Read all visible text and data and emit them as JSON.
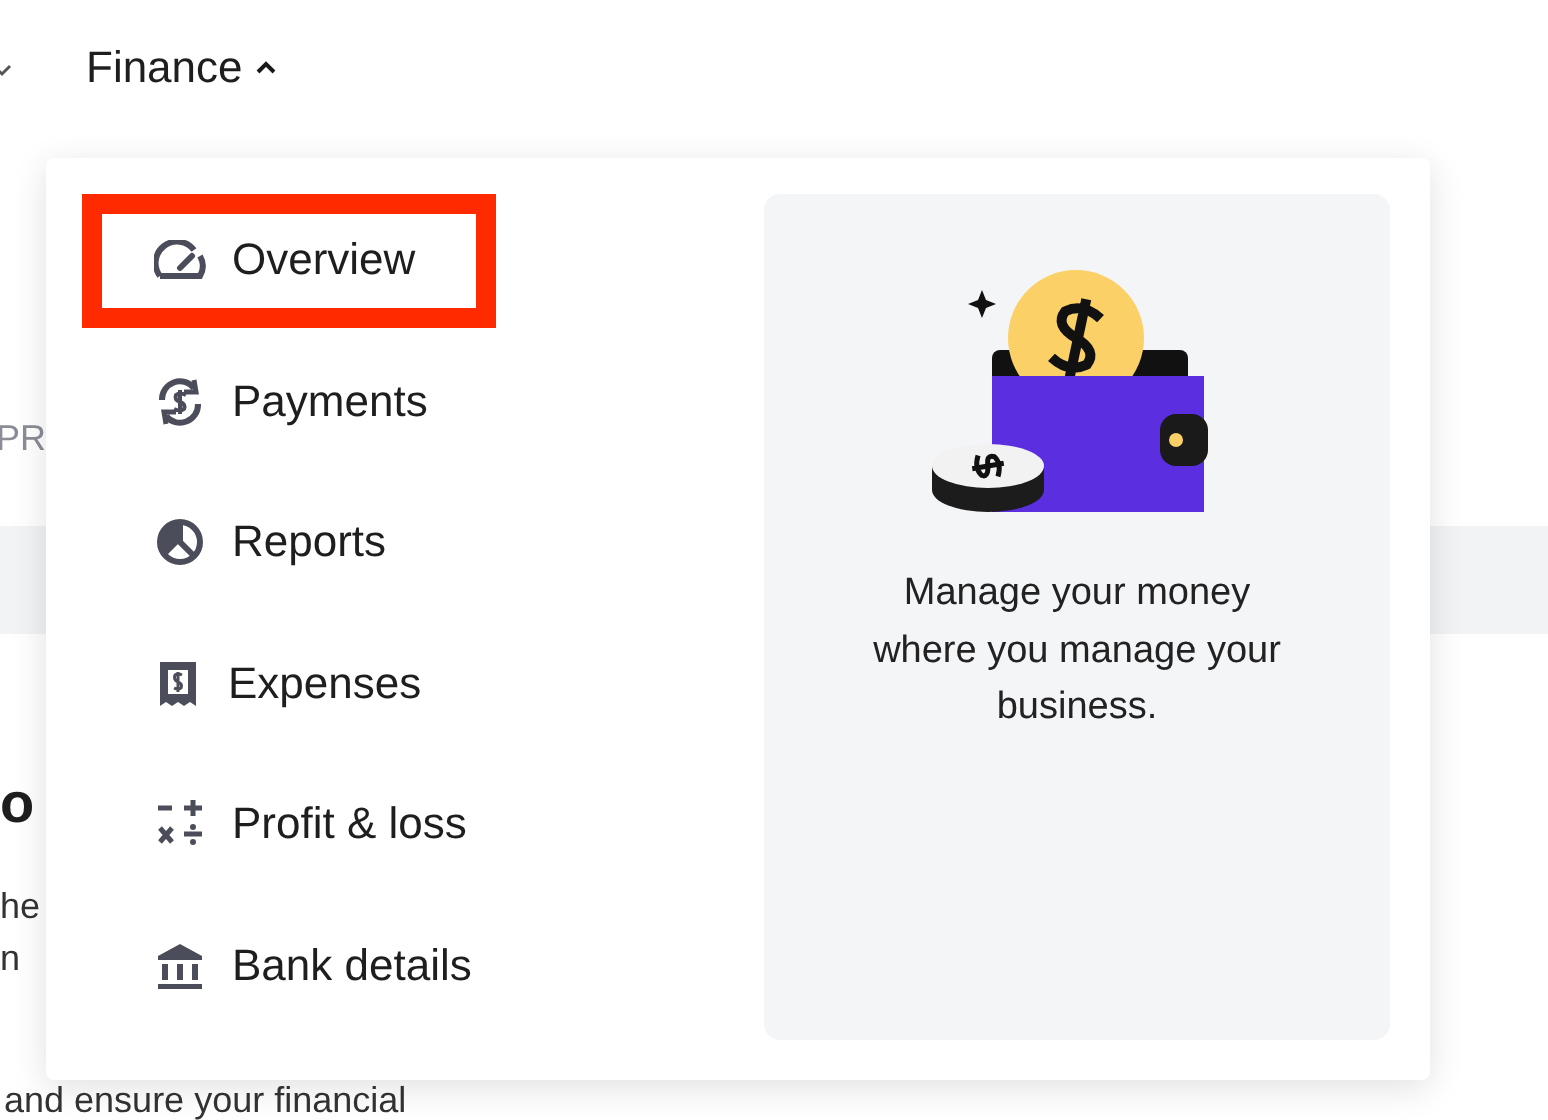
{
  "nav": {
    "label": "Finance",
    "expanded": true
  },
  "background": {
    "tab_fragment": "PR",
    "heading_fragment": "o",
    "line_1": "he",
    "line_2": "n",
    "line_3": "and ensure your financial"
  },
  "menu": {
    "items": [
      {
        "label": "Overview",
        "highlighted": true
      },
      {
        "label": "Payments",
        "highlighted": false
      },
      {
        "label": "Reports",
        "highlighted": false
      },
      {
        "label": "Expenses",
        "highlighted": false
      },
      {
        "label": "Profit & loss",
        "highlighted": false
      },
      {
        "label": "Bank details",
        "highlighted": false
      }
    ],
    "promo": {
      "text": "Manage your money where you manage your business."
    }
  }
}
